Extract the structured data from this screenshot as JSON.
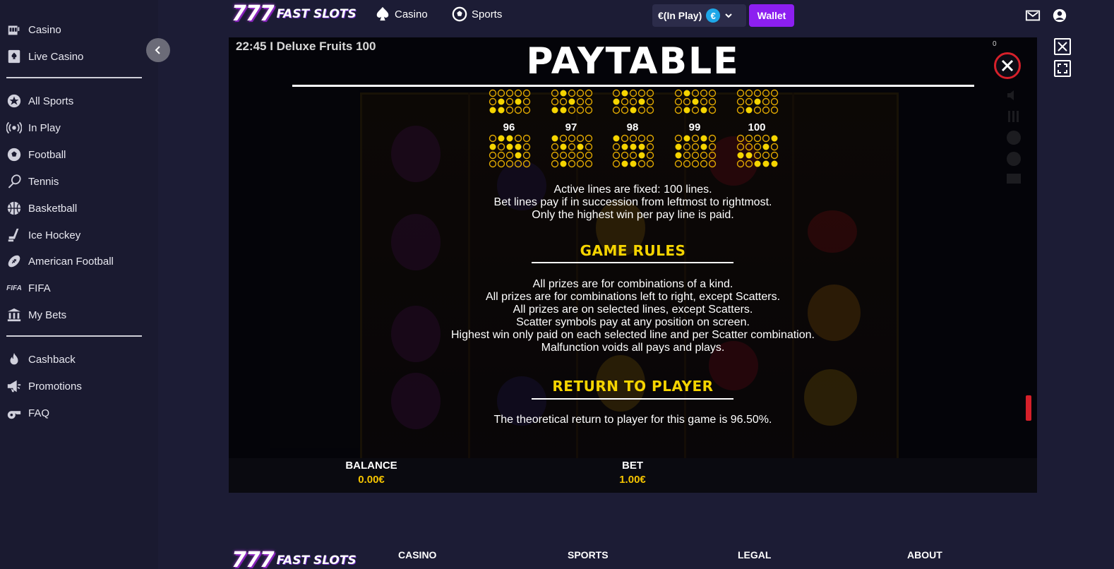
{
  "sidebar": {
    "group1": [
      {
        "label": "Casino",
        "icon": "slot-machine-icon"
      },
      {
        "label": "Live Casino",
        "icon": "spade-card-icon"
      }
    ],
    "group2": [
      {
        "label": "All Sports",
        "icon": "star-badge-icon"
      },
      {
        "label": "In Play",
        "icon": "broadcast-icon"
      },
      {
        "label": "Football",
        "icon": "football-icon"
      },
      {
        "label": "Tennis",
        "icon": "tennis-racket-icon"
      },
      {
        "label": "Basketball",
        "icon": "basketball-icon"
      },
      {
        "label": "Ice Hockey",
        "icon": "hockey-stick-icon"
      },
      {
        "label": "American Football",
        "icon": "american-football-icon"
      },
      {
        "label": "FIFA",
        "icon": "fifa-icon"
      },
      {
        "label": "My Bets",
        "icon": "bets-building-icon"
      }
    ],
    "group3": [
      {
        "label": "Cashback",
        "icon": "flame-icon"
      },
      {
        "label": "Promotions",
        "icon": "megaphone-icon"
      },
      {
        "label": "FAQ",
        "icon": "whistle-icon"
      }
    ]
  },
  "header": {
    "logo_sevens": "777",
    "logo_text": "FAST SLOTS",
    "nav": [
      {
        "label": "Casino",
        "icon": "spade-icon"
      },
      {
        "label": "Sports",
        "icon": "soccer-ball-icon"
      }
    ],
    "balance_label": "€(In Play)",
    "currency_symbol": "€",
    "wallet_label": "Wallet"
  },
  "game": {
    "session_title": "22:45 I Deluxe Fruits 100",
    "counter": "0",
    "paytable_title": "PAYTABLE",
    "line_numbers": [
      "96",
      "97",
      "98",
      "99",
      "100"
    ],
    "lines_text": [
      "Active lines are fixed: 100 lines.",
      "Bet lines pay if in succession from leftmost to rightmost.",
      "Only the highest win per pay line is paid."
    ],
    "game_rules_heading": "GAME RULES",
    "game_rules": [
      "All prizes are for combinations of a kind.",
      "All prizes are for combinations left to right, except Scatters.",
      "All prizes are on selected lines, except Scatters.",
      "Scatter symbols pay at any position on screen.",
      "Highest win only paid on each selected line and per Scatter combination.",
      "Malfunction voids all pays and plays."
    ],
    "rtp_heading": "RETURN TO PLAYER",
    "rtp_text": "The theoretical return to player for this game is 96.50%.",
    "balance_label": "BALANCE",
    "balance_value": "0.00€",
    "bet_label": "BET",
    "bet_value": "1.00€"
  },
  "footer": {
    "logo_sevens": "777",
    "logo_text": "FAST SLOTS",
    "columns": [
      "CASINO",
      "SPORTS",
      "LEGAL",
      "ABOUT"
    ]
  },
  "colors": {
    "accent_purple": "#8c1ff0",
    "heading_yellow": "#f5d400",
    "close_red": "#d6202a",
    "euro_blue": "#1ea7e8"
  }
}
